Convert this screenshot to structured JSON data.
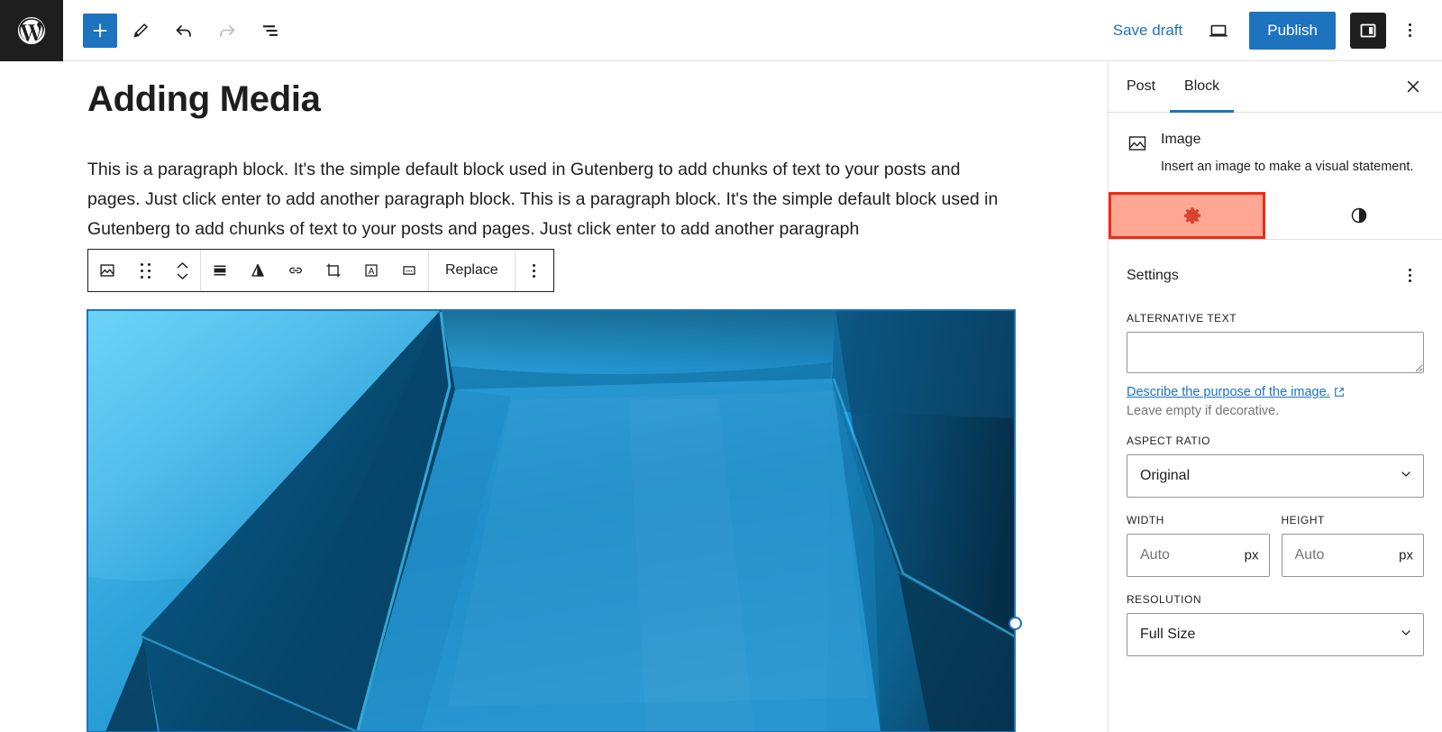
{
  "app": {
    "name": "WordPress Block Editor"
  },
  "topbar": {
    "logo_icon": "wordpress-logo-icon",
    "add_block_label": "+",
    "add_block_icon": "plus-icon",
    "tools_icon": "pencil-edit-icon",
    "undo_icon": "undo-arrow-icon",
    "redo_icon": "redo-arrow-icon",
    "list_view_icon": "list-view-icon",
    "save_draft_label": "Save draft",
    "preview_icon": "laptop-preview-icon",
    "publish_label": "Publish",
    "settings_toggle_icon": "sidebar-panel-icon",
    "more_options_icon": "kebab-menu-icon",
    "accent_color": "#1e73be",
    "logo_bg": "#1e1e1e"
  },
  "editor": {
    "title": "Adding Media",
    "paragraph": "This is a paragraph block. It's the simple default block used in Gutenberg to add chunks of text to your posts and pages. Just click enter to add another paragraph block. This is a paragraph block. It's the simple default block used in Gutenberg to add chunks of text to your posts and pages. Just click enter to add another paragraph",
    "selection_color": "#1e73be"
  },
  "block_toolbar": {
    "block_type_icon": "image-block-icon",
    "drag_handle_icon": "drag-handle-icon",
    "move_icon": "move-up-down-icon",
    "align_icon": "align-full-width-icon",
    "transform_icon": "text-align-triangle-icon",
    "link_icon": "link-icon",
    "crop_icon": "crop-icon",
    "text_over_image_icon": "add-text-over-image-icon",
    "more_formatting_icon": "more-ellipsis-box-icon",
    "replace_label": "Replace",
    "options_icon": "kebab-menu-icon"
  },
  "sidebar": {
    "tabs": [
      {
        "label": "Post",
        "active": false
      },
      {
        "label": "Block",
        "active": true
      }
    ],
    "close_icon": "close-x-icon",
    "block_card": {
      "icon": "image-block-icon",
      "title": "Image",
      "description": "Insert an image to make a visual statement."
    },
    "subtabs": [
      {
        "name": "settings-tab",
        "icon": "gear-settings-icon",
        "active": true,
        "highlighted": true
      },
      {
        "name": "styles-tab",
        "icon": "contrast-half-circle-icon",
        "active": false,
        "highlighted": false
      }
    ],
    "annotation": {
      "color": "#ef2b12",
      "fill": "rgba(255,92,60,0.55)"
    },
    "settings": {
      "heading": "Settings",
      "more_icon": "kebab-menu-icon",
      "alt_text": {
        "label": "Alternative Text",
        "value": "",
        "placeholder": "",
        "help_link": "Describe the purpose of the image.",
        "help_link_icon": "external-link-icon",
        "note": "Leave empty if decorative."
      },
      "aspect_ratio": {
        "label": "Aspect Ratio",
        "value": "Original",
        "chevron_icon": "chevron-down-icon"
      },
      "width": {
        "label": "Width",
        "value": "",
        "placeholder": "Auto",
        "unit": "px"
      },
      "height": {
        "label": "Height",
        "value": "",
        "placeholder": "Auto",
        "unit": "px"
      },
      "resolution": {
        "label": "Resolution",
        "value": "Full Size",
        "chevron_icon": "chevron-down-icon"
      }
    }
  }
}
